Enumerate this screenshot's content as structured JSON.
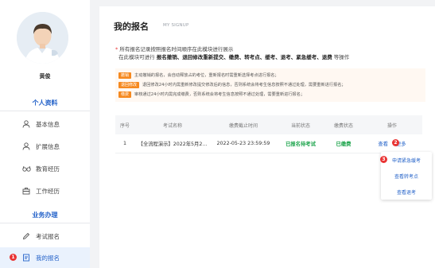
{
  "user": {
    "name": "黄俊"
  },
  "sidebar": {
    "section_profile": "个人资料",
    "profile_items": [
      {
        "label": "基本信息",
        "icon": "user-icon"
      },
      {
        "label": "扩展信息",
        "icon": "user-icon"
      },
      {
        "label": "教育经历",
        "icon": "glasses-icon"
      },
      {
        "label": "工作经历",
        "icon": "briefcase-icon"
      }
    ],
    "section_business": "业务办理",
    "business_items": [
      {
        "label": "考试报名",
        "icon": "edit-icon"
      },
      {
        "label": "我的报名",
        "icon": "document-icon"
      }
    ],
    "badge_1": "1"
  },
  "main": {
    "title": "我的报名",
    "subtitle": "MY SIGNUP",
    "info_line1": "所有报名记录按照报名时间顺序在此模块进行展示",
    "info_line2_pre": "在此模块可进行",
    "info_line2_bold": "报名撤销、退回修改重新提交、缴费、转考点、缓考、退考、紧急缓考、退费",
    "info_line2_post": "等操作",
    "notes": [
      {
        "tag": "撤销",
        "text": "主动撤销的报名，会自动释放占的考位，重新报名时需重新选择考点进行报名；"
      },
      {
        "tag": "退回修改",
        "text": "退回修改24小时内需重新修改提交修改后的信息，否则系统会将考生信息按照不通过处理，需要重新进行报名；"
      },
      {
        "tag": "缴费",
        "text": "审核通过24小时内需完成缴费，否则系统会将考生信息按照不通过处理，需要重新进行报名；"
      }
    ]
  },
  "table": {
    "headers": [
      "序号",
      "考试名称",
      "缴费截止时间",
      "当前状态",
      "缴费状态",
      "操作"
    ],
    "rows": [
      {
        "index": "1",
        "exam": "【全流程演示】2022年5月2...",
        "deadline": "2022-05-23 23:59:59",
        "status": "已报名待考试",
        "pay_status": "已缴费",
        "op_view": "查看",
        "op_more": "更多"
      }
    ],
    "badge_2": "2",
    "badge_3": "3",
    "dropdown": [
      "申请紧急缓考",
      "查看转考点",
      "查看退考"
    ]
  },
  "colors": {
    "accent": "#2563c9",
    "badge": "#e93434",
    "tag": "#f6891f",
    "success": "#1aa34a"
  }
}
